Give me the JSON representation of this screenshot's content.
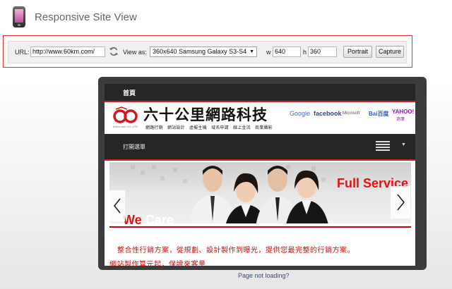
{
  "app": {
    "title": "Responsive Site View"
  },
  "toolbar": {
    "url_label": "URL:",
    "url_value": "http://www.60km.com/",
    "view_as_label": "View as:",
    "device_selected": "360x640 Samsung Galaxy S3-S4",
    "w_label": "w",
    "w_value": "640",
    "h_label": "h",
    "h_value": "360",
    "portrait_label": "Portrait",
    "capture_label": "Capture"
  },
  "site": {
    "topbar_label": "首頁",
    "logo_text": "六十公里網路科技",
    "logo_en": "60km.com CO.,LTD.",
    "logo_tags": "網路行銷　網站設計　虛擬主機　域名申請　線上金流　商業攝影",
    "partners": {
      "google": "Google",
      "facebook": "facebook",
      "microsoft": "Microsoft",
      "baidu": "Bai百度",
      "yahoo": "YAHOO!",
      "yahoo_sub": "奇摩"
    },
    "menu_label": "打開選單",
    "banner_headline": "Full Service",
    "banner_we": "We",
    "banner_care": "Care",
    "tagline_1": "整合性行銷方案，從規劃、設計製作到曝光，提供您最完整的行銷方案。",
    "tagline_2": "網站製作算元起，保證來客量"
  },
  "footer": {
    "page_not_loading": "Page not loading?"
  },
  "colors": {
    "accent_red": "#d82020",
    "dark_bar": "#262626",
    "device_frame": "#3c3c3c",
    "link": "#334a7a"
  },
  "icons": [
    "phone-icon",
    "refresh-icon",
    "hamburger-icon",
    "chevron-left-icon",
    "chevron-right-icon",
    "caret-down-icon"
  ]
}
